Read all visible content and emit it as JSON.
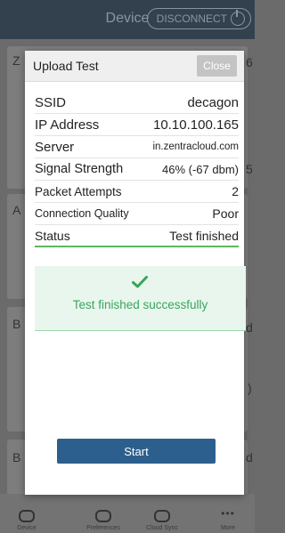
{
  "header": {
    "title": "Device",
    "disconnect_label": "DISCONNECT"
  },
  "background_fragments": [
    "Z",
    "A",
    "B",
    "B",
    "d",
    "d",
    ")",
    "5",
    "6"
  ],
  "bottom_nav": [
    {
      "label": "Device",
      "icon": "router-icon"
    },
    {
      "label": "Preferences",
      "icon": "gear-icon"
    },
    {
      "label": "Cloud Sync",
      "icon": "cloud-sync-icon"
    },
    {
      "label": "More",
      "icon": "more-icon"
    }
  ],
  "modal": {
    "title": "Upload Test",
    "close_label": "Close",
    "rows": [
      {
        "label": "SSID",
        "value": "decagon"
      },
      {
        "label": "IP Address",
        "value": "10.10.100.165"
      },
      {
        "label": "Server",
        "value": "in.zentracloud.com"
      },
      {
        "label": "Signal Strength",
        "value": "46% (-67 dbm)"
      },
      {
        "label": "Packet Attempts",
        "value": "2"
      },
      {
        "label": "Connection Quality",
        "value": "Poor"
      },
      {
        "label": "Status",
        "value": "Test finished"
      }
    ],
    "success_message": "Test finished successfully",
    "start_label": "Start"
  },
  "colors": {
    "accent_blue": "#2d5f8e",
    "success_green": "#3aa55a",
    "success_bg": "#e8f6ee"
  }
}
